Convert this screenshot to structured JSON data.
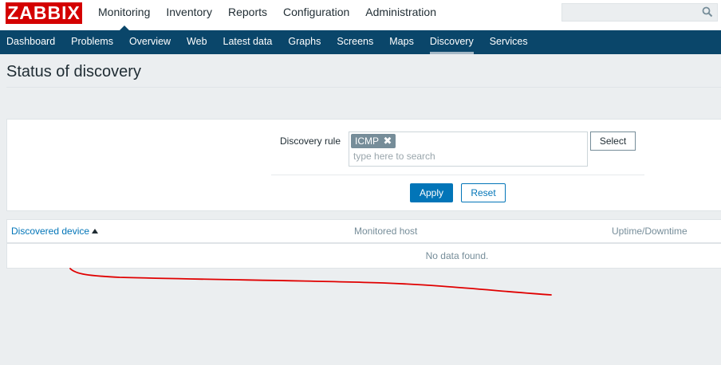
{
  "header": {
    "logo_text": "ZABBIX",
    "main_menu": [
      "Monitoring",
      "Inventory",
      "Reports",
      "Configuration",
      "Administration"
    ],
    "active_main": "Monitoring",
    "search_icon": "search-icon"
  },
  "sub_menu": {
    "items": [
      "Dashboard",
      "Problems",
      "Overview",
      "Web",
      "Latest data",
      "Graphs",
      "Screens",
      "Maps",
      "Discovery",
      "Services"
    ],
    "active": "Discovery"
  },
  "page": {
    "title": "Status of discovery"
  },
  "filter": {
    "label": "Discovery rule",
    "selected_tag": "ICMP",
    "remove_glyph": "✖",
    "placeholder": "type here to search",
    "select_label": "Select",
    "apply_label": "Apply",
    "reset_label": "Reset"
  },
  "table": {
    "columns": [
      "Discovered device",
      "Monitored host",
      "Uptime/Downtime"
    ],
    "sorted_column": "Discovered device",
    "empty_text": "No data found."
  },
  "annotation": {
    "color": "#e00000"
  },
  "colors": {
    "brand": "#d40000",
    "nav": "#0a466a",
    "accent": "#0275b8"
  }
}
